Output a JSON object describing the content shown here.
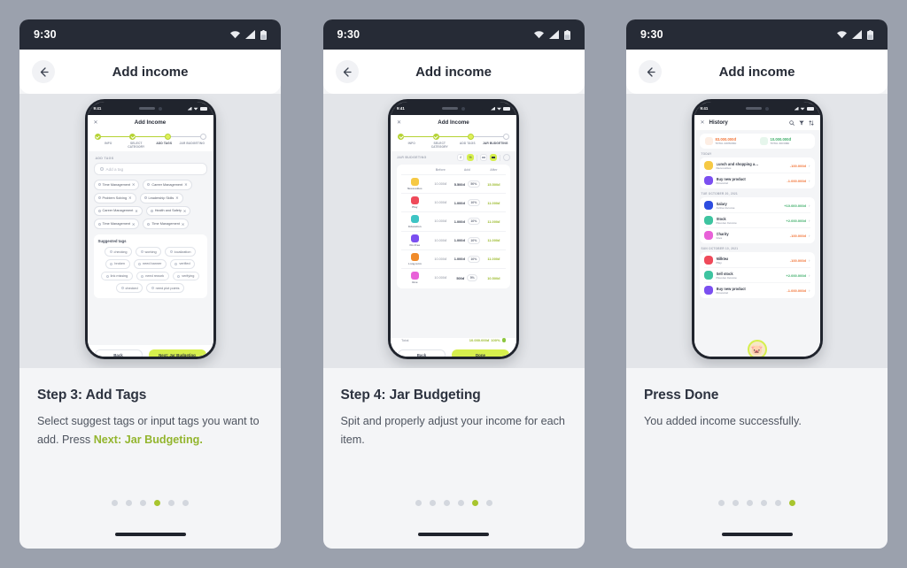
{
  "device": {
    "status_time": "9:30",
    "icons": [
      "wifi-icon",
      "signal-icon",
      "battery-icon"
    ]
  },
  "header": {
    "title": "Add income",
    "back_icon": "arrow-left-icon"
  },
  "phone_mock": {
    "status_time": "9:41",
    "close_icon": "close-icon"
  },
  "panels": [
    {
      "id": "step3",
      "caption_title": "Step 3: Add Tags",
      "caption_text_before": "Select suggest tags or input tags you want to add. Press ",
      "caption_highlight": "Next: Jar Budgeting.",
      "dots_total": 6,
      "dots_active": 4,
      "screen": {
        "title": "Add Income",
        "stepper": [
          {
            "label": "INFO",
            "state": "done"
          },
          {
            "label": "SELECT CATEGORY",
            "state": "done"
          },
          {
            "label": "ADD TAGS",
            "state": "current"
          },
          {
            "label": "JAR BUDGETING",
            "state": "todo"
          }
        ],
        "section_label": "ADD TAGS",
        "input_placeholder": "Add a tag",
        "tags": [
          "Time Management",
          "Career Management",
          "Problem Solving",
          "Leadership Skills",
          "Career Management",
          "Health and Safety",
          "Time Management",
          "Time Management"
        ],
        "suggested_title": "Suggested tags",
        "suggested": [
          "checking",
          "working",
          "localization",
          "broken",
          "need banner",
          "verified",
          "link missing",
          "need rework",
          "verifying",
          "checked",
          "need plot points"
        ],
        "btn_back": "Back",
        "btn_next": "Next: Jar Budgeting"
      }
    },
    {
      "id": "step4",
      "caption_title": "Step 4: Jar Budgeting",
      "caption_text_before": "Spit and properly adjust your income for each item.",
      "caption_highlight": "",
      "dots_total": 6,
      "dots_active": 5,
      "screen": {
        "title": "Add Income",
        "stepper": [
          {
            "label": "INFO",
            "state": "done"
          },
          {
            "label": "SELECT CATEGORY",
            "state": "done"
          },
          {
            "label": "ADD TAGS",
            "state": "done"
          },
          {
            "label": "JAR BUDGETING",
            "state": "current"
          }
        ],
        "section_label": "JAR BUDGETING",
        "toggle_currency": "đ",
        "toggle_percent": "%",
        "columns": [
          "",
          "Before",
          "Add",
          "After"
        ],
        "rows": [
          {
            "jar": "Necessities",
            "color": "#f6c944",
            "before": "10.000đ",
            "add": "5.500đ",
            "pct": "50%",
            "after": "15.500đ"
          },
          {
            "jar": "Play",
            "color": "#ef4a5a",
            "before": "10.000đ",
            "add": "1.000đ",
            "pct": "10%",
            "after": "11.000đ"
          },
          {
            "jar": "Education",
            "color": "#3ec4c4",
            "before": "10.000đ",
            "add": "1.000đ",
            "pct": "10%",
            "after": "11.000đ"
          },
          {
            "jar": "Fin.Free",
            "color": "#7b4ff0",
            "before": "10.000đ",
            "add": "1.000đ",
            "pct": "10%",
            "after": "11.000đ"
          },
          {
            "jar": "Long-term",
            "color": "#f08b2a",
            "before": "10.000đ",
            "add": "1.000đ",
            "pct": "10%",
            "after": "11.000đ"
          },
          {
            "jar": "Give",
            "color": "#e861d8",
            "before": "10.000đ",
            "add": "500đ",
            "pct": "5%",
            "after": "10.500đ"
          }
        ],
        "total_label": "Total",
        "total_value": "10.000.000đ",
        "total_pct": "100%",
        "btn_back": "Back",
        "btn_next": "Done"
      }
    },
    {
      "id": "done",
      "caption_title": "Press Done",
      "caption_text_before": "You added income successfully.",
      "caption_highlight": "",
      "dots_total": 6,
      "dots_active": 6,
      "screen": {
        "title": "History",
        "actions": [
          "search-icon",
          "filter-icon",
          "sort-icon"
        ],
        "summary": [
          {
            "value": "83.000.000đ",
            "label": "TOTAL EXPENSE",
            "color": "#f2763a",
            "icon_color": "#fdeee4"
          },
          {
            "value": "10.000.000đ",
            "label": "TOTAL INCOME",
            "color": "#3fae6a",
            "icon_color": "#e6f6ec"
          }
        ],
        "groups": [
          {
            "day": "TODAY",
            "items": [
              {
                "name": "Lunch and shopping a…",
                "sub": "Necessities",
                "amount": "-100.000đ",
                "sign": "neg",
                "color": "#f6c944"
              },
              {
                "name": "Buy new product",
                "sub": "Financial",
                "amount": "-1.000.000đ",
                "sign": "neg",
                "color": "#7b4ff0"
              }
            ]
          },
          {
            "day": "TUE OCTOBER 20, 2021",
            "items": [
              {
                "name": "Salary",
                "sub": "Active Income",
                "amount": "+10.000.000đ",
                "sign": "pos",
                "color": "#2d4de0"
              },
              {
                "name": "Stock",
                "sub": "Passive Income",
                "amount": "+2.000.000đ",
                "sign": "pos",
                "color": "#3ec4a0"
              },
              {
                "name": "Charity",
                "sub": "Give",
                "amount": "-100.000đ",
                "sign": "neg",
                "color": "#e861d8"
              }
            ]
          },
          {
            "day": "SUN OCTOBER 10, 2021",
            "items": [
              {
                "name": "Milktea",
                "sub": "Play",
                "amount": "-100.000đ",
                "sign": "neg",
                "color": "#ef4a5a"
              },
              {
                "name": "Sell stock",
                "sub": "Passive Income",
                "amount": "+2.000.000đ",
                "sign": "pos",
                "color": "#3ec4a0"
              },
              {
                "name": "Buy new product",
                "sub": "Financial",
                "amount": "-1.000.000đ",
                "sign": "neg",
                "color": "#7b4ff0"
              }
            ]
          }
        ],
        "mascot": "mascot-avatar"
      }
    }
  ],
  "colors": {
    "background": "#9ba1ad",
    "panel": "#f4f5f7",
    "lime": "#d6ef4d",
    "lime_dark": "#a8c52f",
    "dark": "#20242d"
  }
}
